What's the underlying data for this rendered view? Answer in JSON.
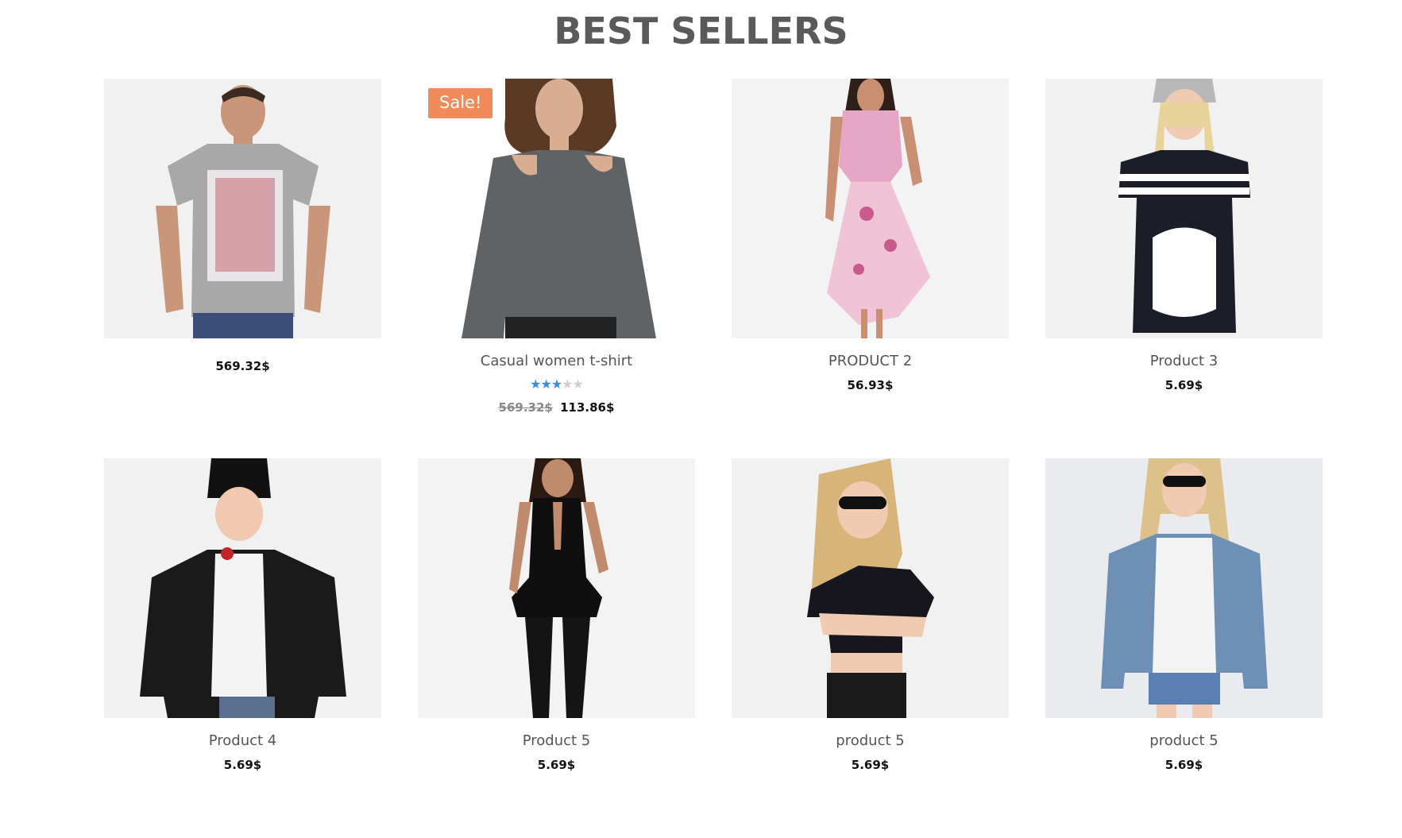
{
  "section": {
    "title": "BEST SELLERS"
  },
  "colors": {
    "sale_badge": "#ef8a5b",
    "star_active": "#3a8ee0",
    "star_inactive": "#cfcfcf",
    "title": "#5a5a5a"
  },
  "products": [
    {
      "name": "",
      "price": "569.32$",
      "image": "man-grey-tshirt"
    },
    {
      "name": "Casual women t-shirt",
      "badge": "Sale!",
      "rating": 3,
      "rating_max": 5,
      "old_price": "569.32$",
      "price": "113.86$",
      "image": "woman-grey-cold-shoulder-top"
    },
    {
      "name": "PRODUCT 2",
      "price": "56.93$",
      "image": "woman-floral-dress"
    },
    {
      "name": "Product 3",
      "price": "5.69$",
      "image": "woman-black-jersey"
    },
    {
      "name": "Product 4",
      "price": "5.69$",
      "image": "woman-leather-jacket"
    },
    {
      "name": "Product 5",
      "price": "5.69$",
      "image": "woman-black-jumpsuit"
    },
    {
      "name": "product 5",
      "price": "5.69$",
      "image": "woman-black-crop-top"
    },
    {
      "name": "product 5",
      "price": "5.69$",
      "image": "woman-denim-jacket"
    }
  ]
}
